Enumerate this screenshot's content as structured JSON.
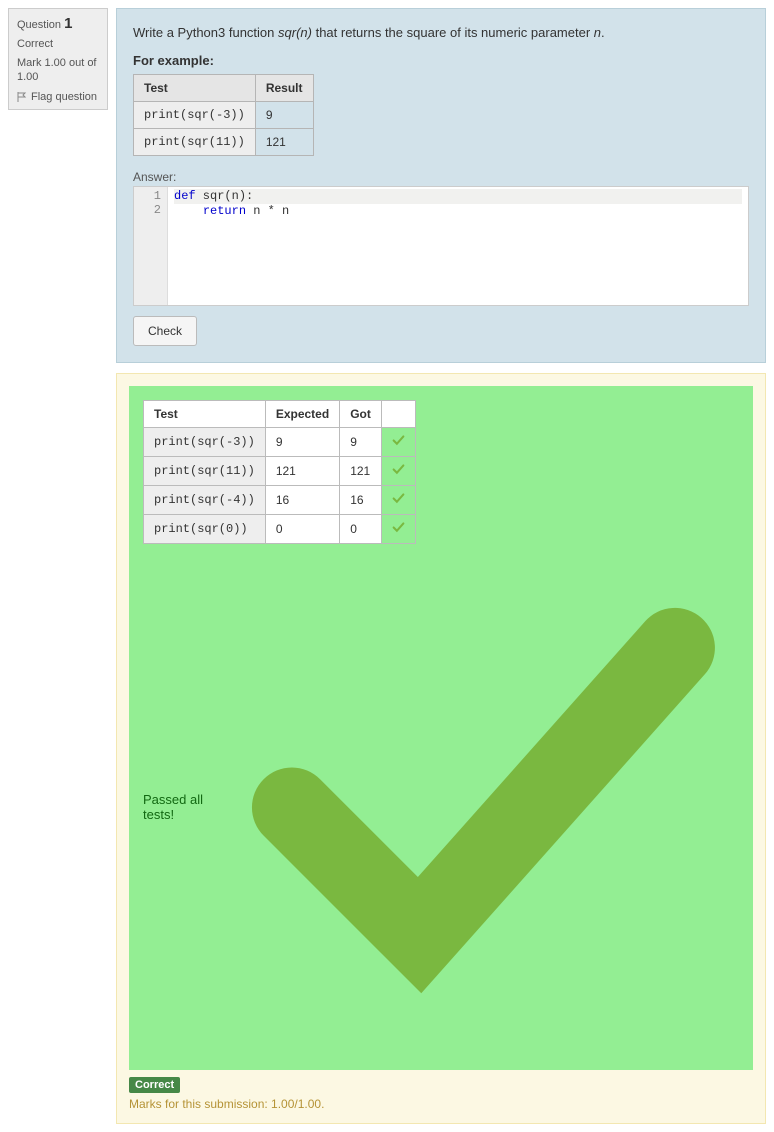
{
  "info": {
    "question_label": "Question",
    "question_number": "1",
    "state": "Correct",
    "mark_text": "Mark 1.00 out of 1.00",
    "flag_label": "Flag question"
  },
  "question": {
    "prompt_pre": "Write a Python3 function ",
    "prompt_fn": "sqr(n)",
    "prompt_mid": " that returns the square of its numeric parameter ",
    "prompt_param": "n",
    "prompt_post": ".",
    "for_example": "For example:",
    "example_headers": {
      "test": "Test",
      "result": "Result"
    },
    "examples": [
      {
        "test": "print(sqr(-3))",
        "result": "9"
      },
      {
        "test": "print(sqr(11))",
        "result": "121"
      }
    ],
    "answer_label": "Answer:",
    "code": {
      "line1_kw": "def",
      "line1_rest": " sqr(n):",
      "line2_indent": "    ",
      "line2_kw": "return",
      "line2_rest": " n * n"
    },
    "check_label": "Check"
  },
  "results": {
    "headers": {
      "test": "Test",
      "expected": "Expected",
      "got": "Got"
    },
    "rows": [
      {
        "test": "print(sqr(-3))",
        "expected": "9",
        "got": "9"
      },
      {
        "test": "print(sqr(11))",
        "expected": "121",
        "got": "121"
      },
      {
        "test": "print(sqr(-4))",
        "expected": "16",
        "got": "16"
      },
      {
        "test": "print(sqr(0))",
        "expected": "0",
        "got": "0"
      }
    ],
    "passed_label": "Passed all tests!",
    "correct_badge": "Correct",
    "marks_text": "Marks for this submission: 1.00/1.00."
  }
}
